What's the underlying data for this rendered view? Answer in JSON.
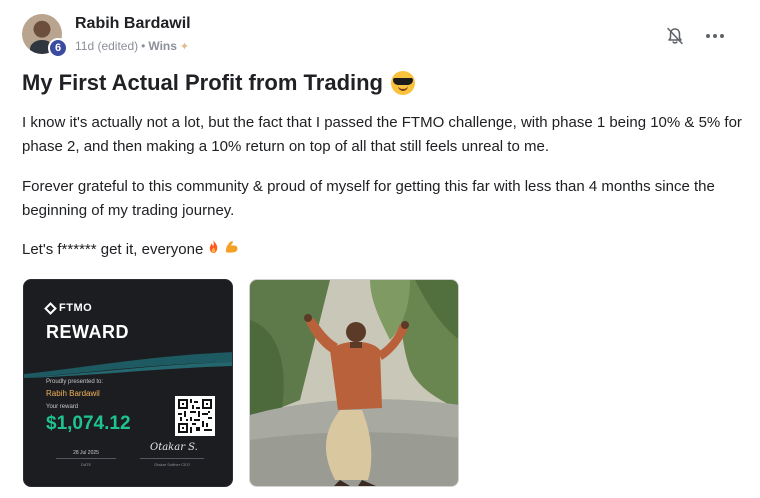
{
  "author": {
    "name": "Rabih Bardawil",
    "level": "6"
  },
  "meta": {
    "time": "11d (edited)",
    "separator": "•",
    "category": "Wins",
    "category_icon": "clap-icon"
  },
  "post": {
    "title": "My First Actual Profit from Trading",
    "title_emoji": "sunglasses-face",
    "paragraph1": "I know it's actually not a lot, but the fact that I passed the FTMO challenge, with phase 1 being 10% & 5% for phase 2, and then making a 10% return on top of all that still feels unreal to me.",
    "paragraph2": "Forever grateful to this community & proud of myself for getting this far with less than 4 months since the beginning of my trading journey.",
    "paragraph3": "Let's f****** get it, everyone",
    "paragraph3_emojis": [
      "fire",
      "flexed-biceps"
    ]
  },
  "certificate": {
    "brand": "FTMO",
    "heading": "REWARD",
    "presented_label": "Proudly presented to:",
    "recipient": "Rabih Bardawil",
    "reward_label": "Your reward",
    "amount": "$1,074.12",
    "date": "28 Jul 2025",
    "date_label": "DATE",
    "signature": "Otakar S.",
    "signer_label": "Otakar Suffner CEO"
  },
  "colors": {
    "badge": "#3b4ba0",
    "amount_green": "#1ec38f",
    "recipient_gold": "#f0b35a"
  }
}
